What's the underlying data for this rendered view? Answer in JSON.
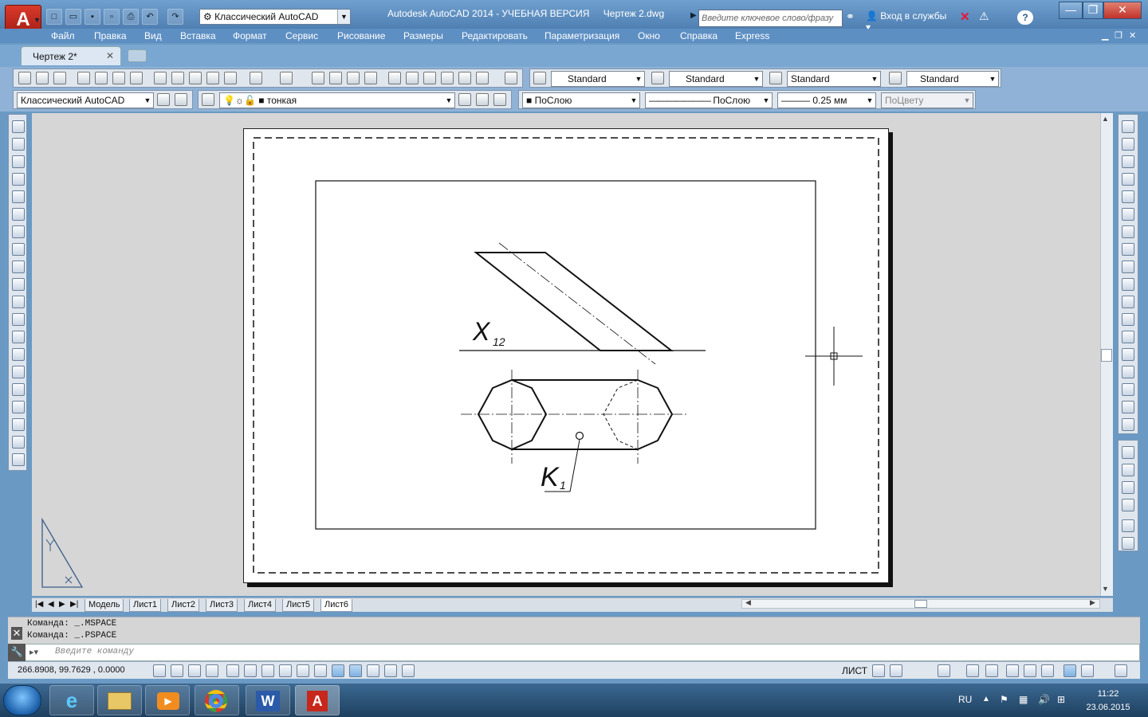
{
  "app": {
    "title": "Autodesk AutoCAD 2014 - УЧЕБНАЯ ВЕРСИЯ",
    "document": "Чертеж 2.dwg",
    "workspace": "Классический AutoCAD",
    "search_placeholder": "Введите ключевое слово/фразу",
    "signin": "Вход в службы"
  },
  "menu": [
    "Файл",
    "Правка",
    "Вид",
    "Вставка",
    "Формат",
    "Сервис",
    "Рисование",
    "Размеры",
    "Редактировать",
    "Параметризация",
    "Окно",
    "Справка",
    "Express"
  ],
  "doc_tab": "Чертеж 2*",
  "styles": {
    "text_style": "Standard",
    "dim_style": "Standard",
    "table_style": "Standard",
    "multileader_style": "Standard"
  },
  "properties": {
    "workspace": "Классический AutoCAD",
    "layer": "тонкая",
    "color": "ПоСлою",
    "linetype": "ПоСлою",
    "lineweight": "0.25 мм",
    "plotstyle": "ПоЦвету"
  },
  "drawing": {
    "label_x": "X",
    "label_x_sub": "12",
    "label_k": "K",
    "label_k_sub": "1"
  },
  "layout_tabs": [
    "Модель",
    "Лист1",
    "Лист2",
    "Лист3",
    "Лист4",
    "Лист5",
    "Лист6"
  ],
  "active_layout": "Лист6",
  "command_history": [
    "Команда:  _.MSPACE",
    "Команда:  _.PSPACE"
  ],
  "command_placeholder": "Введите команду",
  "coords": "266.8908, 99.7629 , 0.0000",
  "space_label": "ЛИСТ",
  "tray": {
    "lang": "RU",
    "time": "11:22",
    "date": "23.06.2015"
  }
}
